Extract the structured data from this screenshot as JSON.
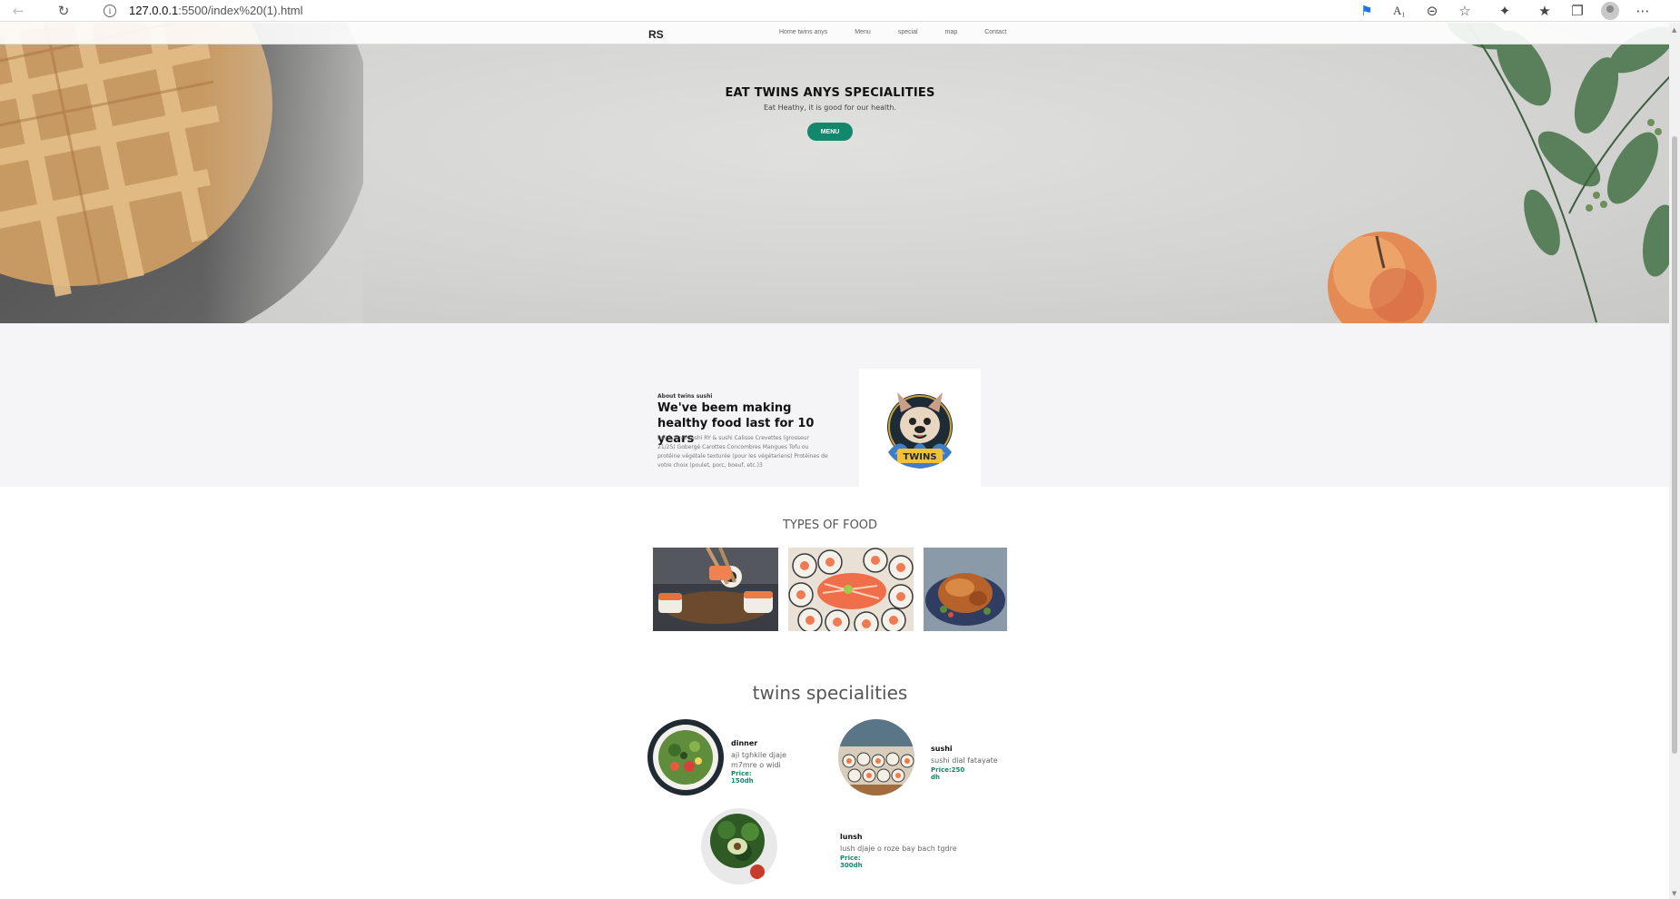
{
  "browser": {
    "url_host": "127.0.0.1",
    "url_rest": ":5500/index%20(1).html"
  },
  "nav": {
    "logo": "RS",
    "links": [
      "Home twins anys",
      "Menu",
      "special",
      "map",
      "Contact"
    ]
  },
  "hero": {
    "title": "EAT TWINS ANYS SPECIALITIES",
    "subtitle": "Eat Heathy, it is good for our health.",
    "button": "MENU"
  },
  "about": {
    "label": "About twins sushi",
    "heading": "We've beem making healthy food last for 10 years",
    "description": "twins anys sushi RY & sushi Calisse Crevettes (grosseur 21/25) Gobergé Carottes Concombres Mangues Tofu ou protéine végétale texturée (pour les végétariens) Protéines de votre choix (poulet, porc, boeuf, etc.)3"
  },
  "types": {
    "title": "TYPES OF FOOD"
  },
  "specialities": {
    "title": "twins specialities",
    "items": [
      {
        "name": "dinner",
        "text": "aji tghkile djaje m7mre o widi",
        "price": "Price: 150dh"
      },
      {
        "name": "sushi",
        "text": "sushi dial fatayate",
        "price": "Price:250 dh"
      },
      {
        "name": "lunsh",
        "text": "lush djaje o roze bay bach tgdre",
        "price": "Price: 300dh"
      }
    ]
  }
}
